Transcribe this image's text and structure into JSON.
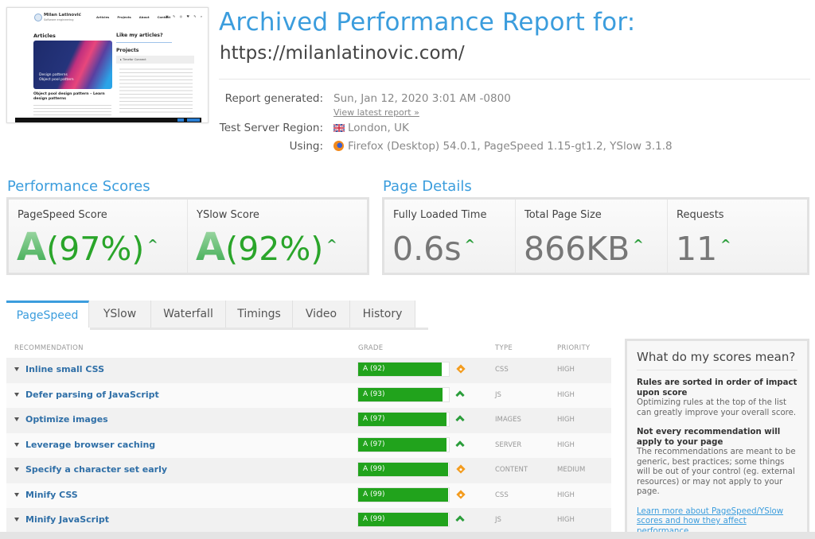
{
  "thumbnail": {
    "site_name": "Milan Latinović",
    "site_tagline": "Software engineering",
    "nav": [
      "Articles",
      "Projects",
      "About",
      "Contact"
    ],
    "social_icons": "▣ ✎ ◎ ♥ ✎ ⌕",
    "articles_heading": "Articles",
    "hero_text": [
      "Design patterns",
      "Object pool pattern"
    ],
    "post_title": "Object pool design pattern – Learn design patterns",
    "sidebar_heading": "Like my articles?",
    "projects_heading": "Projects",
    "project_item": "▸ Timefor Connect"
  },
  "header": {
    "title": "Archived Performance Report for:",
    "url": "https://milanlatinovic.com/"
  },
  "meta": {
    "report_generated_label": "Report generated:",
    "report_generated_value": "Sun, Jan 12, 2020 3:01 AM -0800",
    "view_latest_link": "View latest report »",
    "region_label": "Test Server Region:",
    "region_value": "London, UK",
    "using_label": "Using:",
    "using_value": "Firefox (Desktop) 54.0.1, PageSpeed 1.15-gt1.2, YSlow 3.1.8"
  },
  "performance_scores": {
    "heading": "Performance Scores",
    "items": [
      {
        "label": "PageSpeed Score",
        "grade": "A",
        "percent": "(97%)",
        "trend": "^"
      },
      {
        "label": "YSlow Score",
        "grade": "A",
        "percent": "(92%)",
        "trend": "^"
      }
    ]
  },
  "page_details": {
    "heading": "Page Details",
    "items": [
      {
        "label": "Fully Loaded Time",
        "value": "0.6s",
        "trend": "^"
      },
      {
        "label": "Total Page Size",
        "value": "866KB",
        "trend": "^"
      },
      {
        "label": "Requests",
        "value": "11",
        "trend": "^"
      }
    ]
  },
  "tabs": [
    {
      "label": "PageSpeed",
      "active": true
    },
    {
      "label": "YSlow",
      "active": false
    },
    {
      "label": "Waterfall",
      "active": false
    },
    {
      "label": "Timings",
      "active": false
    },
    {
      "label": "Video",
      "active": false
    },
    {
      "label": "History",
      "active": false
    }
  ],
  "table": {
    "headers": {
      "recommendation": "RECOMMENDATION",
      "grade": "GRADE",
      "type": "TYPE",
      "priority": "PRIORITY"
    },
    "rows": [
      {
        "recommendation": "Inline small CSS",
        "grade_label": "A (92)",
        "score": 92,
        "trend": "diamond-icon",
        "type": "CSS",
        "priority": "HIGH"
      },
      {
        "recommendation": "Defer parsing of JavaScript",
        "grade_label": "A (93)",
        "score": 93,
        "trend": "chevron-up-icon",
        "type": "JS",
        "priority": "HIGH"
      },
      {
        "recommendation": "Optimize images",
        "grade_label": "A (97)",
        "score": 97,
        "trend": "chevron-up-icon",
        "type": "IMAGES",
        "priority": "HIGH"
      },
      {
        "recommendation": "Leverage browser caching",
        "grade_label": "A (97)",
        "score": 97,
        "trend": "chevron-up-icon",
        "type": "SERVER",
        "priority": "HIGH"
      },
      {
        "recommendation": "Specify a character set early",
        "grade_label": "A (99)",
        "score": 99,
        "trend": "diamond-icon",
        "type": "CONTENT",
        "priority": "MEDIUM"
      },
      {
        "recommendation": "Minify CSS",
        "grade_label": "A (99)",
        "score": 99,
        "trend": "diamond-icon",
        "type": "CSS",
        "priority": "HIGH"
      },
      {
        "recommendation": "Minify JavaScript",
        "grade_label": "A (99)",
        "score": 99,
        "trend": "chevron-up-icon",
        "type": "JS",
        "priority": "HIGH"
      }
    ]
  },
  "side_box": {
    "title": "What do my scores mean?",
    "sections": [
      {
        "bold": "Rules are sorted in order of impact upon score",
        "text": "Optimizing rules at the top of the list can greatly improve your overall score."
      },
      {
        "bold": "Not every recommendation will apply to your page",
        "text": "The recommendations are meant to be generic, best practices; some things will be out of your control (eg. external resources) or may not apply to your page."
      }
    ],
    "link": "Learn more about PageSpeed/YSlow scores and how they affect performance."
  },
  "colors": {
    "accent": "#3b9ddd",
    "grade_green": "#21a31c",
    "trend_up": "#2c9e3c",
    "trend_neutral": "#f39c1f",
    "link_blue": "#2f6fa7"
  }
}
